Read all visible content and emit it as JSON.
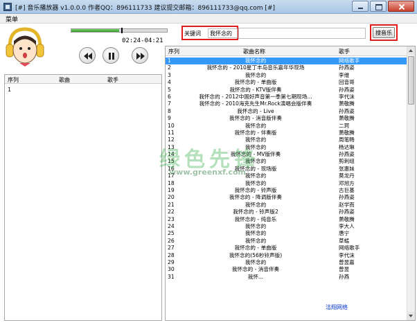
{
  "window": {
    "title": "[#] 音乐播放器 v1.0.0.0   作者QQ：896111733  建议提交邮箱：896111733@qq.com [#]"
  },
  "menu": {
    "label": "菜单"
  },
  "player": {
    "time": "02:24-04:21",
    "progress": 0.5
  },
  "search": {
    "label": "关键词",
    "value": "我怀念的",
    "button": "搜音乐"
  },
  "left_panel": {
    "headers": [
      "序列",
      "歌曲",
      "歌手"
    ],
    "rows": [
      {
        "num": "1",
        "name": "",
        "artist": ""
      }
    ]
  },
  "song_list": {
    "headers": [
      "序列",
      "歌曲名称",
      "歌手"
    ],
    "selected_index": 0,
    "rows": [
      {
        "num": "1",
        "name": "我怀念的",
        "artist": "网络歌手"
      },
      {
        "num": "2",
        "name": "我怀念的 - 2010星丁丰岛音乐嘉年华现场",
        "artist": "孙燕姿"
      },
      {
        "num": "3",
        "name": "我怀念的",
        "artist": "李维"
      },
      {
        "num": "4",
        "name": "我怀念的 - 单曲版",
        "artist": "回音哥"
      },
      {
        "num": "5",
        "name": "我怀念的 - KTV版伴奏",
        "artist": "孙燕姿"
      },
      {
        "num": "6",
        "name": "我怀念的 - 2012中国好声音第一季第七期现场...",
        "artist": "李代沫"
      },
      {
        "num": "7",
        "name": "我怀念的 - 2010海克先生Mr.Rock演唱会版伴奏",
        "artist": "萧敬腾"
      },
      {
        "num": "8",
        "name": "我怀念的 - Live",
        "artist": "孙燕姿"
      },
      {
        "num": "9",
        "name": "我怀念的 - 消音版伴奏",
        "artist": "萧敬腾"
      },
      {
        "num": "10",
        "name": "我怀念的",
        "artist": "二珂"
      },
      {
        "num": "11",
        "name": "我怀念的 - 伴奏版",
        "artist": "萧敬腾"
      },
      {
        "num": "12",
        "name": "我怀念的",
        "artist": "周笔畅"
      },
      {
        "num": "13",
        "name": "我怀念的",
        "artist": "杨达琳"
      },
      {
        "num": "14",
        "name": "我怀念的 - MV版伴奏",
        "artist": "孙燕姿"
      },
      {
        "num": "15",
        "name": "我怀念的",
        "artist": "剪刺组"
      },
      {
        "num": "16",
        "name": "我怀念的 - 现场版",
        "artist": "张惠妹"
      },
      {
        "num": "17",
        "name": "我怀念的",
        "artist": "莫龙丹"
      },
      {
        "num": "18",
        "name": "我怀念的",
        "artist": "邓旭方"
      },
      {
        "num": "19",
        "name": "我怀念的 - 铃声版",
        "artist": "古巨基"
      },
      {
        "num": "20",
        "name": "我怀念的 - 降调版伴奏",
        "artist": "孙燕姿"
      },
      {
        "num": "21",
        "name": "我怀念的",
        "artist": "赵学而"
      },
      {
        "num": "22",
        "name": "我怀念的 - 铃声版2",
        "artist": "孙燕姿"
      },
      {
        "num": "23",
        "name": "我怀念的 - 纯音乐",
        "artist": "萧敬腾"
      },
      {
        "num": "24",
        "name": "我怀念的",
        "artist": "李大人"
      },
      {
        "num": "25",
        "name": "我怀念的",
        "artist": "唐宁"
      },
      {
        "num": "26",
        "name": "我怀念的",
        "artist": "草蜢"
      },
      {
        "num": "27",
        "name": "我怀念的 - 单曲版",
        "artist": "网络歌手"
      },
      {
        "num": "28",
        "name": "我怀念的(56秒铃声版)",
        "artist": "李代沫"
      },
      {
        "num": "29",
        "name": "我怀念的",
        "artist": "曾昱嘉"
      },
      {
        "num": "30",
        "name": "我怀念的 - 消音伴奏",
        "artist": "曾昱"
      },
      {
        "num": "31",
        "name": "我怀...",
        "artist": "孙燕"
      }
    ]
  },
  "watermark": {
    "main": "绿色先锋",
    "sub": "www.greenxf.com"
  },
  "footer": {
    "link": "洁翔网络"
  }
}
